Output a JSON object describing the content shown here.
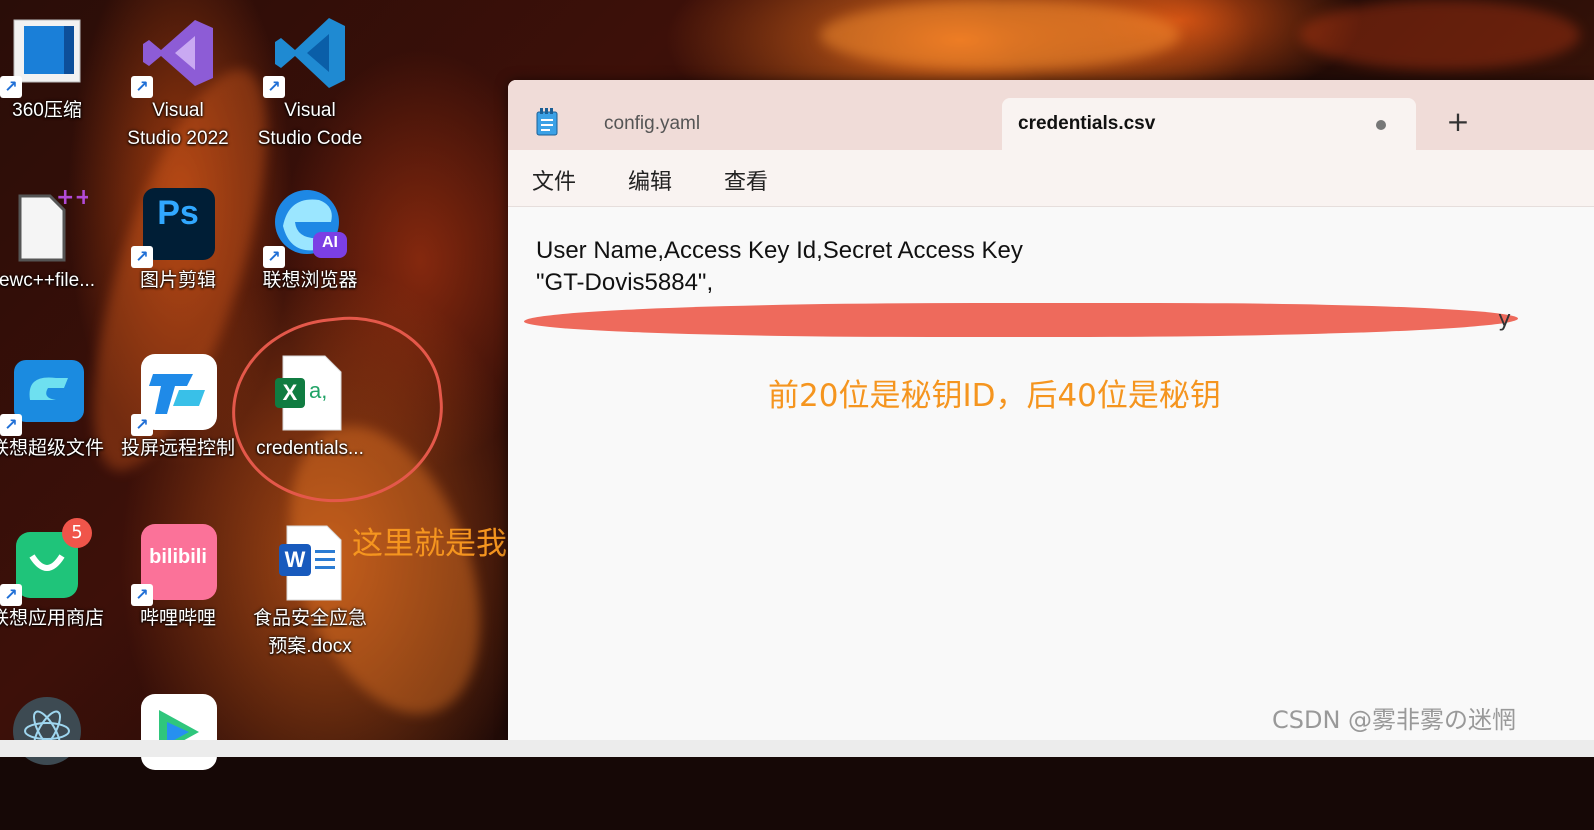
{
  "desktop": {
    "icons": [
      {
        "label": "360压缩",
        "icon": "archive-icon"
      },
      {
        "label": "Visual\nStudio 2022",
        "icon": "visual-studio-icon"
      },
      {
        "label": "Visual\nStudio Code",
        "icon": "vscode-icon"
      },
      {
        "label": "ewc++file...",
        "icon": "file-icon"
      },
      {
        "label": "图片剪辑",
        "icon": "photoshop-icon",
        "glyph": "Ps"
      },
      {
        "label": "联想浏览器",
        "icon": "browser-icon",
        "glyph": "AI"
      },
      {
        "label": "联想超级文件",
        "icon": "super-file-icon"
      },
      {
        "label": "投屏远程控制",
        "icon": "remote-control-icon"
      },
      {
        "label": "credentials...",
        "icon": "excel-csv-icon",
        "glyph": "X",
        "glyph2": "a,"
      },
      {
        "label": "联想应用商店",
        "icon": "app-store-icon",
        "badge": "5"
      },
      {
        "label": "哔哩哔哩",
        "icon": "bilibili-icon",
        "glyph": "bilibili"
      },
      {
        "label": "食品安全应急\n预案.docx",
        "icon": "word-icon",
        "glyph": "W"
      }
    ],
    "annotation": "这里就是我保存的那个文档"
  },
  "notepad": {
    "tabs": [
      {
        "label": "config.yaml"
      },
      {
        "label": "credentials.csv"
      }
    ],
    "new_tab": "+",
    "menu": [
      "文件",
      "编辑",
      "查看"
    ],
    "content": {
      "line1": "User Name,Access Key Id,Secret Access Key",
      "line2": "\"GT-Dovis5884\",",
      "line3_tail": "y"
    },
    "annotation": "前20位是秘钥ID，后40位是秘钥"
  },
  "watermark": "CSDN @雾非雾の迷惘",
  "colors": {
    "annotation": "#f5951f",
    "circle": "#e4584a",
    "redaction": "#ee6a5c",
    "titlebar": "#f0dcd8"
  }
}
